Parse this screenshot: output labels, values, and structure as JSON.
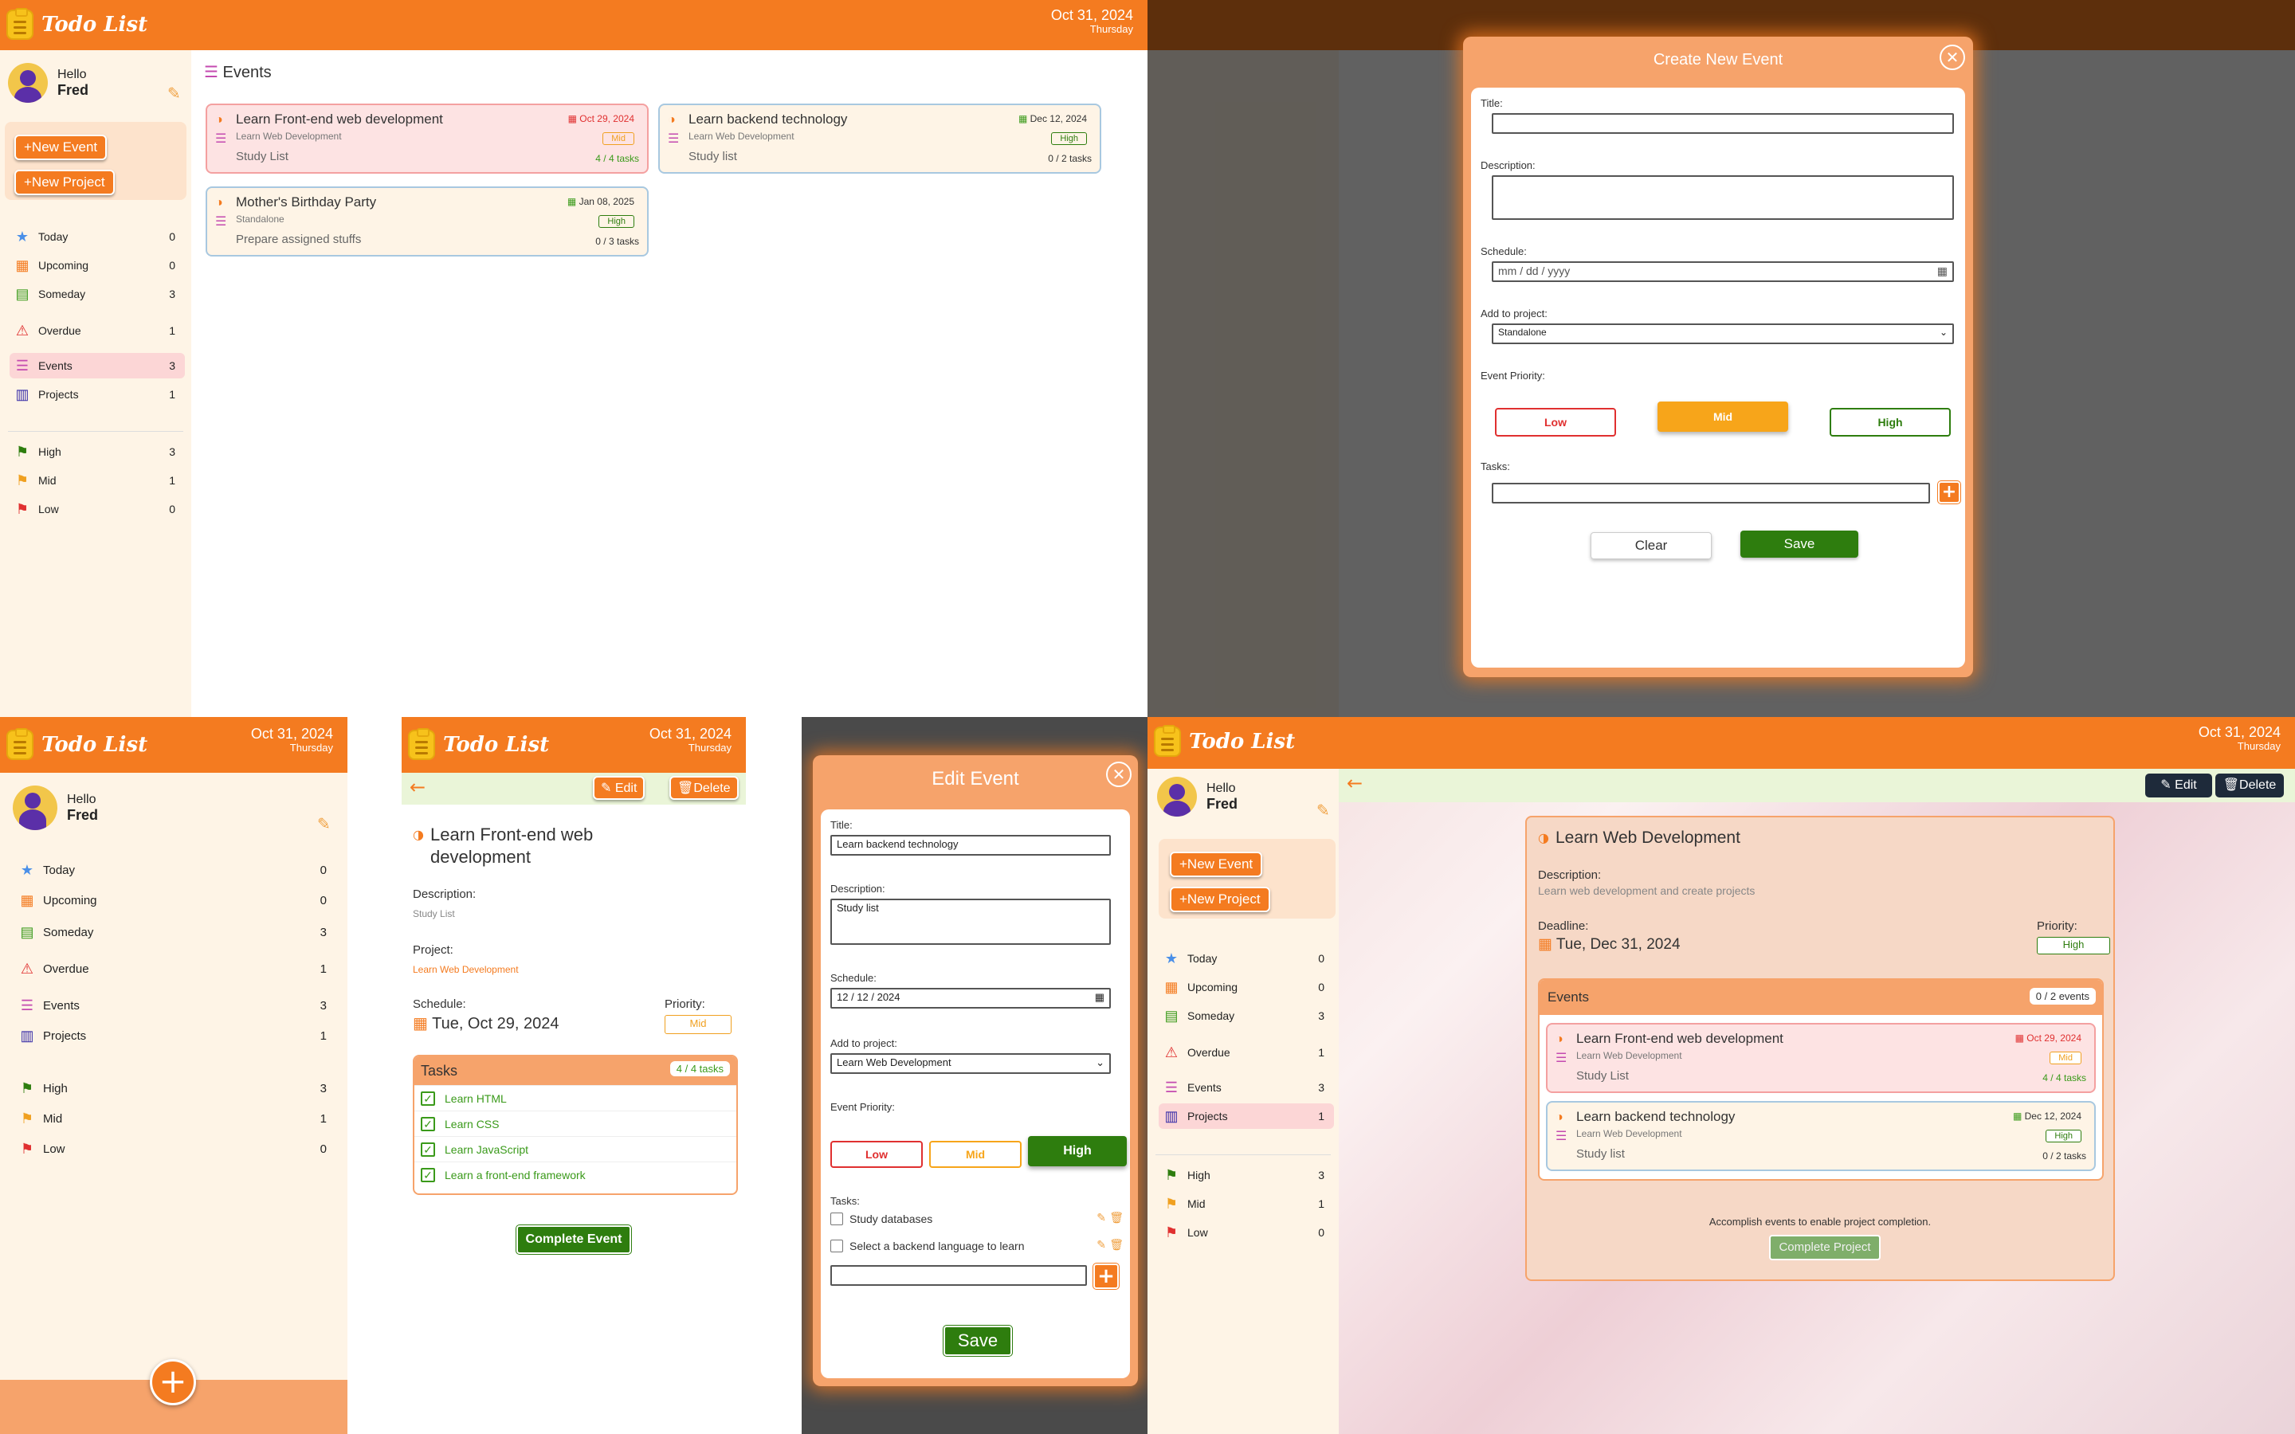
{
  "app": {
    "title": "Todo List",
    "date": "Oct 31, 2024",
    "weekday": "Thursday"
  },
  "user": {
    "greeting": "Hello",
    "name": "Fred"
  },
  "actions": {
    "new_event": "+New Event",
    "new_project": "+New Project"
  },
  "nav": [
    {
      "label": "Today",
      "count": "0",
      "icon": "star-icon",
      "color": "#4a8fe8"
    },
    {
      "label": "Upcoming",
      "count": "0",
      "icon": "calendar-icon",
      "color": "#f47b20"
    },
    {
      "label": "Someday",
      "count": "3",
      "icon": "archive-icon",
      "color": "#3a9a1a"
    },
    {
      "label": "Overdue",
      "count": "1",
      "icon": "alert-icon",
      "color": "#e03030"
    },
    {
      "label": "Events",
      "count": "3",
      "icon": "event-list-icon",
      "color": "#c44ab0"
    },
    {
      "label": "Projects",
      "count": "1",
      "icon": "projects-icon",
      "color": "#3a2fa8"
    }
  ],
  "priorities": [
    {
      "label": "High",
      "count": "3",
      "color": "#2e7d0e"
    },
    {
      "label": "Mid",
      "count": "1",
      "color": "#f0a020"
    },
    {
      "label": "Low",
      "count": "0",
      "color": "#e03030"
    }
  ],
  "events_page": {
    "title": "Events",
    "events": [
      {
        "title": "Learn Front-end web development",
        "project": "Learn Web Development",
        "desc": "Study List",
        "date": "Oct 29, 2024",
        "priority": "Mid",
        "tasks": "4 / 4 tasks"
      },
      {
        "title": "Learn backend technology",
        "project": "Learn Web Development",
        "desc": "Study list",
        "date": "Dec 12, 2024",
        "priority": "High",
        "tasks": "0 / 2 tasks"
      },
      {
        "title": "Mother's Birthday Party",
        "project": "Standalone",
        "desc": "Prepare assigned stuffs",
        "date": "Jan 08, 2025",
        "priority": "High",
        "tasks": "0 / 3 tasks"
      }
    ]
  },
  "create_modal": {
    "title": "Create New Event",
    "title_label": "Title:",
    "desc_label": "Description:",
    "schedule_label": "Schedule:",
    "schedule_placeholder": "mm / dd / yyyy",
    "project_label": "Add to project:",
    "project_value": "Standalone",
    "priority_label": "Event Priority:",
    "low": "Low",
    "mid": "Mid",
    "high": "High",
    "tasks_label": "Tasks:",
    "clear": "Clear",
    "save": "Save"
  },
  "event_detail": {
    "edit": "Edit",
    "delete": "Delete",
    "title": "Learn Front-end web development",
    "desc_label": "Description:",
    "desc": "Study List",
    "project_label": "Project:",
    "project": "Learn Web Development",
    "schedule_label": "Schedule:",
    "schedule": "Tue, Oct 29, 2024",
    "priority_label": "Priority:",
    "priority": "Mid",
    "tasks_title": "Tasks",
    "tasks_count": "4 / 4 tasks",
    "tasks": [
      "Learn HTML",
      "Learn CSS",
      "Learn JavaScript",
      "Learn a front-end framework"
    ],
    "complete": "Complete Event"
  },
  "edit_modal": {
    "title": "Edit Event",
    "title_label": "Title:",
    "title_value": "Learn backend technology",
    "desc_label": "Description:",
    "desc_value": "Study list",
    "schedule_label": "Schedule:",
    "schedule_value": "12 / 12 / 2024",
    "project_label": "Add to project:",
    "project_value": "Learn Web Development",
    "priority_label": "Event Priority:",
    "low": "Low",
    "mid": "Mid",
    "high": "High",
    "tasks_label": "Tasks:",
    "tasks": [
      "Study databases",
      "Select a backend language to learn"
    ],
    "save": "Save"
  },
  "project_detail": {
    "edit": "Edit",
    "delete": "Delete",
    "title": "Learn Web Development",
    "desc_label": "Description:",
    "desc": "Learn web development and create projects",
    "deadline_label": "Deadline:",
    "deadline": "Tue, Dec 31, 2024",
    "priority_label": "Priority:",
    "priority": "High",
    "events_title": "Events",
    "events_count": "0 / 2 events",
    "note": "Accomplish events to enable project completion.",
    "complete": "Complete Project"
  }
}
